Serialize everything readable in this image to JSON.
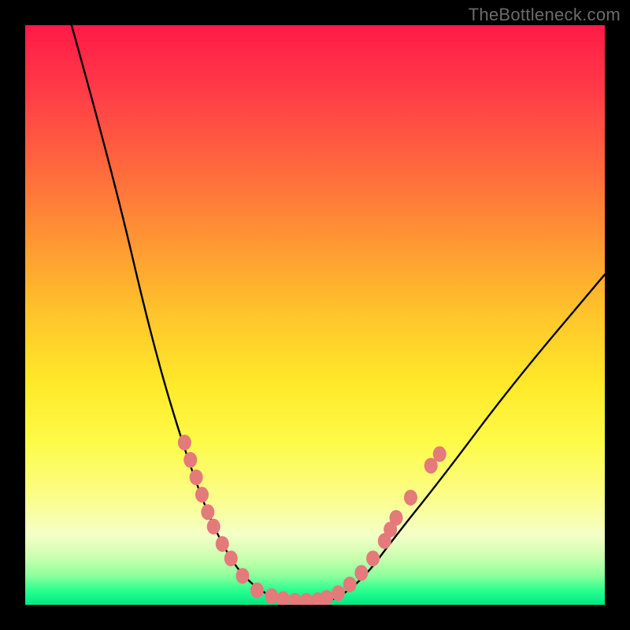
{
  "watermark": "TheBottleneck.com",
  "chart_data": {
    "type": "line",
    "title": "",
    "xlabel": "",
    "ylabel": "",
    "xlim": [
      0,
      100
    ],
    "ylim": [
      0,
      100
    ],
    "grid": false,
    "legend": false,
    "curve_nodes": [
      {
        "x": 8,
        "y": 100
      },
      {
        "x": 15,
        "y": 75
      },
      {
        "x": 22,
        "y": 45
      },
      {
        "x": 28,
        "y": 25
      },
      {
        "x": 33,
        "y": 12
      },
      {
        "x": 38,
        "y": 4
      },
      {
        "x": 45,
        "y": 0
      },
      {
        "x": 52,
        "y": 0
      },
      {
        "x": 58,
        "y": 4
      },
      {
        "x": 64,
        "y": 12
      },
      {
        "x": 72,
        "y": 22
      },
      {
        "x": 84,
        "y": 38
      },
      {
        "x": 100,
        "y": 57
      }
    ],
    "left_markers": [
      {
        "x": 27.5,
        "y": 28
      },
      {
        "x": 28.5,
        "y": 25
      },
      {
        "x": 29.5,
        "y": 22
      },
      {
        "x": 30.5,
        "y": 19
      },
      {
        "x": 31.5,
        "y": 16
      },
      {
        "x": 32.5,
        "y": 13.5
      },
      {
        "x": 34.0,
        "y": 10.5
      },
      {
        "x": 35.5,
        "y": 8
      },
      {
        "x": 37.5,
        "y": 5
      },
      {
        "x": 40.0,
        "y": 2.5
      }
    ],
    "right_markers": [
      {
        "x": 54.0,
        "y": 2.0
      },
      {
        "x": 56.0,
        "y": 3.5
      },
      {
        "x": 58.0,
        "y": 5.5
      },
      {
        "x": 60.0,
        "y": 8.0
      },
      {
        "x": 62.0,
        "y": 11.0
      },
      {
        "x": 63.0,
        "y": 13.0
      },
      {
        "x": 64.0,
        "y": 15.0
      },
      {
        "x": 66.5,
        "y": 18.5
      },
      {
        "x": 70.0,
        "y": 24.0
      },
      {
        "x": 71.5,
        "y": 26.0
      }
    ],
    "bottom_markers": [
      {
        "x": 42.5,
        "y": 1.5
      },
      {
        "x": 44.5,
        "y": 1.0
      },
      {
        "x": 46.5,
        "y": 0.7
      },
      {
        "x": 48.5,
        "y": 0.7
      },
      {
        "x": 50.5,
        "y": 0.8
      },
      {
        "x": 52.0,
        "y": 1.2
      }
    ],
    "colors": {
      "curve": "#000000",
      "marker_fill": "#e47a7a",
      "marker_stroke": "#c95c5c"
    }
  }
}
